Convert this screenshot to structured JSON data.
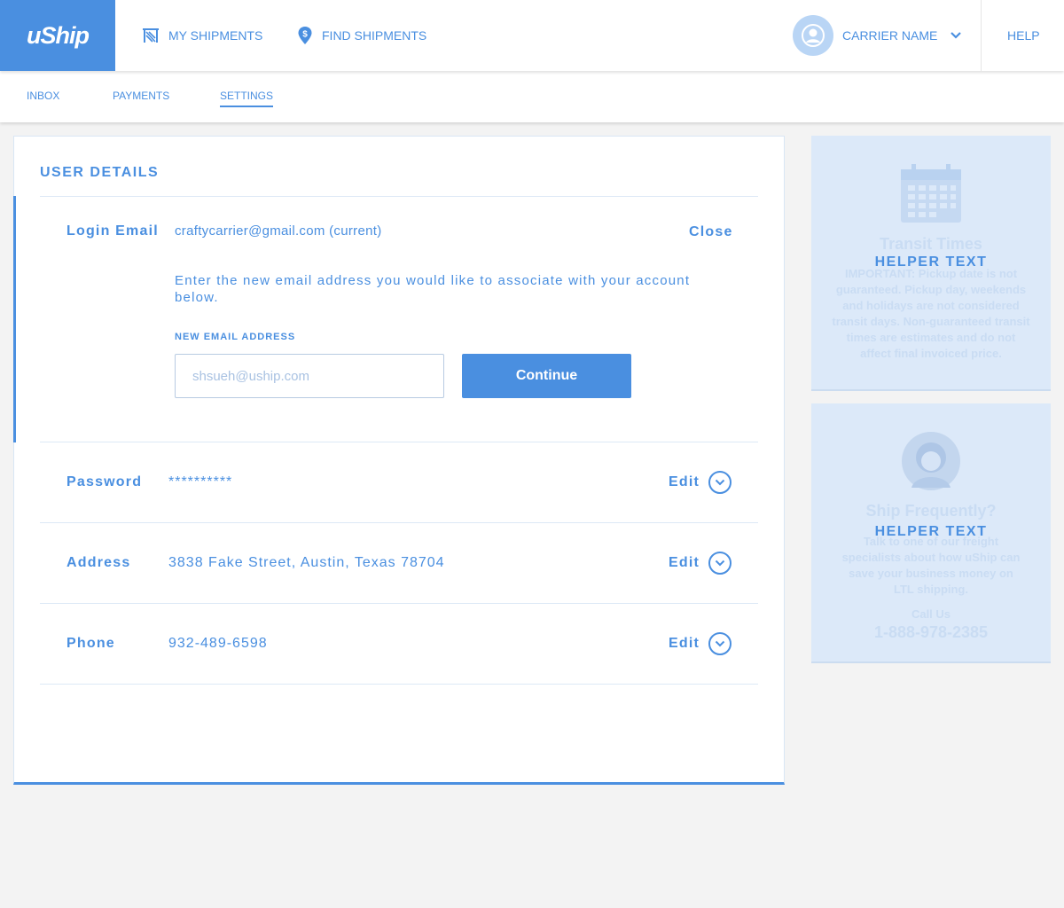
{
  "header": {
    "logo": "uShip",
    "nav": [
      {
        "label": "MY SHIPMENTS",
        "icon": "shipments-icon"
      },
      {
        "label": "FIND SHIPMENTS",
        "icon": "map-pin-dollar-icon"
      }
    ],
    "user": {
      "name": "CARRIER NAME",
      "icon": "user-avatar-icon"
    },
    "help": "HELP"
  },
  "subnav": {
    "items": [
      "INBOX",
      "PAYMENTS",
      "SETTINGS"
    ],
    "active": "SETTINGS"
  },
  "user_details": {
    "title": "USER DETAILS",
    "login_email": {
      "label": "Login Email",
      "value": "craftycarrier@gmail.com (current)",
      "action": "Close",
      "instructions": "Enter the new email address you would like to associate with your account below.",
      "field_label": "NEW EMAIL ADDRESS",
      "placeholder": "shsueh@uship.com",
      "button": "Continue"
    },
    "rows": [
      {
        "label": "Password",
        "value": "**********",
        "action": "Edit"
      },
      {
        "label": "Address",
        "value": "3838 Fake Street, Austin, Texas 78704",
        "action": "Edit"
      },
      {
        "label": "Phone",
        "value": "932-489-6598",
        "action": "Edit"
      }
    ]
  },
  "side_panels": {
    "transit": {
      "title": "Transit Times",
      "helper": "HELPER TEXT",
      "body_bold": "IMPORTANT:",
      "body": "Pickup date is not guaranteed. Pickup day, weekends and holidays are not considered transit days. Non-guaranteed transit times are estimates and do not affect final invoiced price."
    },
    "ship": {
      "title": "Ship Frequently?",
      "helper": "HELPER TEXT",
      "body": "Talk to one of our freight specialists about how uShip can save your business money on LTL shipping.",
      "call_label": "Call Us",
      "phone": "1-888-978-2385"
    }
  },
  "colors": {
    "accent": "#4a8fe0",
    "panel": "#dce9f9",
    "background": "#f3f3f3"
  }
}
